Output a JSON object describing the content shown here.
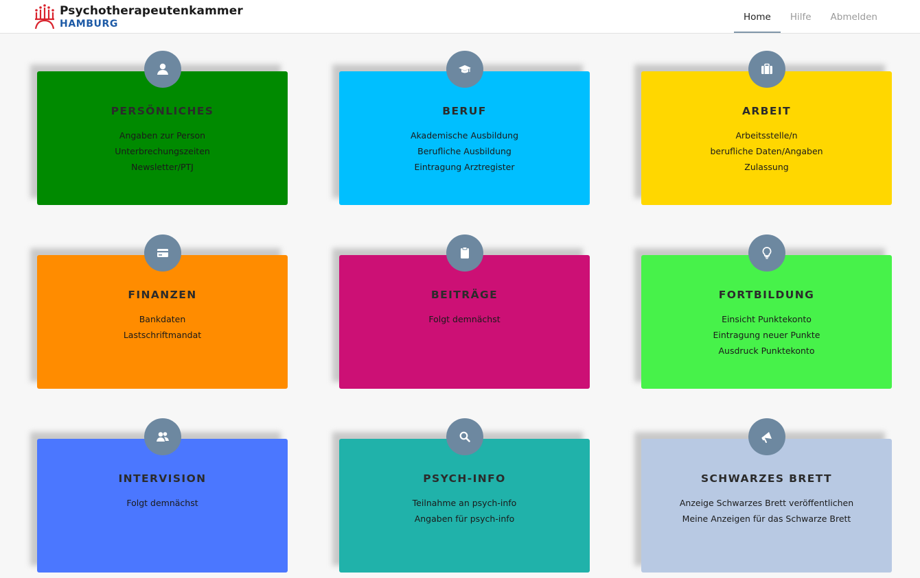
{
  "header": {
    "logo_line1": "Psychotherapeutenkammer",
    "logo_line2": "HAMBURG",
    "nav": [
      {
        "label": "Home",
        "active": true
      },
      {
        "label": "Hilfe",
        "active": false
      },
      {
        "label": "Abmelden",
        "active": false
      }
    ]
  },
  "colors": {
    "icon_circle": "#6d88a0",
    "logo_red": "#d9232d",
    "logo_blue": "#1d5aa6"
  },
  "cards": [
    {
      "title": "PERSÖNLICHES",
      "icon": "user-icon",
      "color": "#008a00",
      "items": [
        "Angaben zur Person",
        "Unterbrechungszeiten",
        "Newsletter/PTJ"
      ]
    },
    {
      "title": "BERUF",
      "icon": "graduation-cap-icon",
      "color": "#00bfff",
      "items": [
        "Akademische Ausbildung",
        "Berufliche Ausbildung",
        "Eintragung Arztregister"
      ]
    },
    {
      "title": "ARBEIT",
      "icon": "briefcase-icon",
      "color": "#ffd700",
      "items": [
        "Arbeitsstelle/n",
        "berufliche Daten/Angaben",
        "Zulassung"
      ]
    },
    {
      "title": "FINANZEN",
      "icon": "credit-card-icon",
      "color": "#ff8c00",
      "items": [
        "Bankdaten",
        "Lastschriftmandat"
      ]
    },
    {
      "title": "BEITRÄGE",
      "icon": "clipboard-icon",
      "color": "#cc1075",
      "items": [
        "Folgt demnächst"
      ]
    },
    {
      "title": "FORTBILDUNG",
      "icon": "lightbulb-icon",
      "color": "#47f24a",
      "items": [
        "Einsicht Punktekonto",
        "Eintragung neuer Punkte",
        "Ausdruck Punktekonto"
      ]
    },
    {
      "title": "INTERVISION",
      "icon": "users-icon",
      "color": "#4b77ff",
      "items": [
        "Folgt demnächst"
      ]
    },
    {
      "title": "PSYCH-INFO",
      "icon": "search-icon",
      "color": "#20b2aa",
      "items": [
        "Teilnahme an psych-info",
        "Angaben für psych-info"
      ]
    },
    {
      "title": "SCHWARZES BRETT",
      "icon": "megaphone-icon",
      "color": "#b8c9e3",
      "items": [
        "Anzeige Schwarzes Brett veröffentlichen",
        "Meine Anzeigen für das Schwarze Brett"
      ]
    }
  ]
}
